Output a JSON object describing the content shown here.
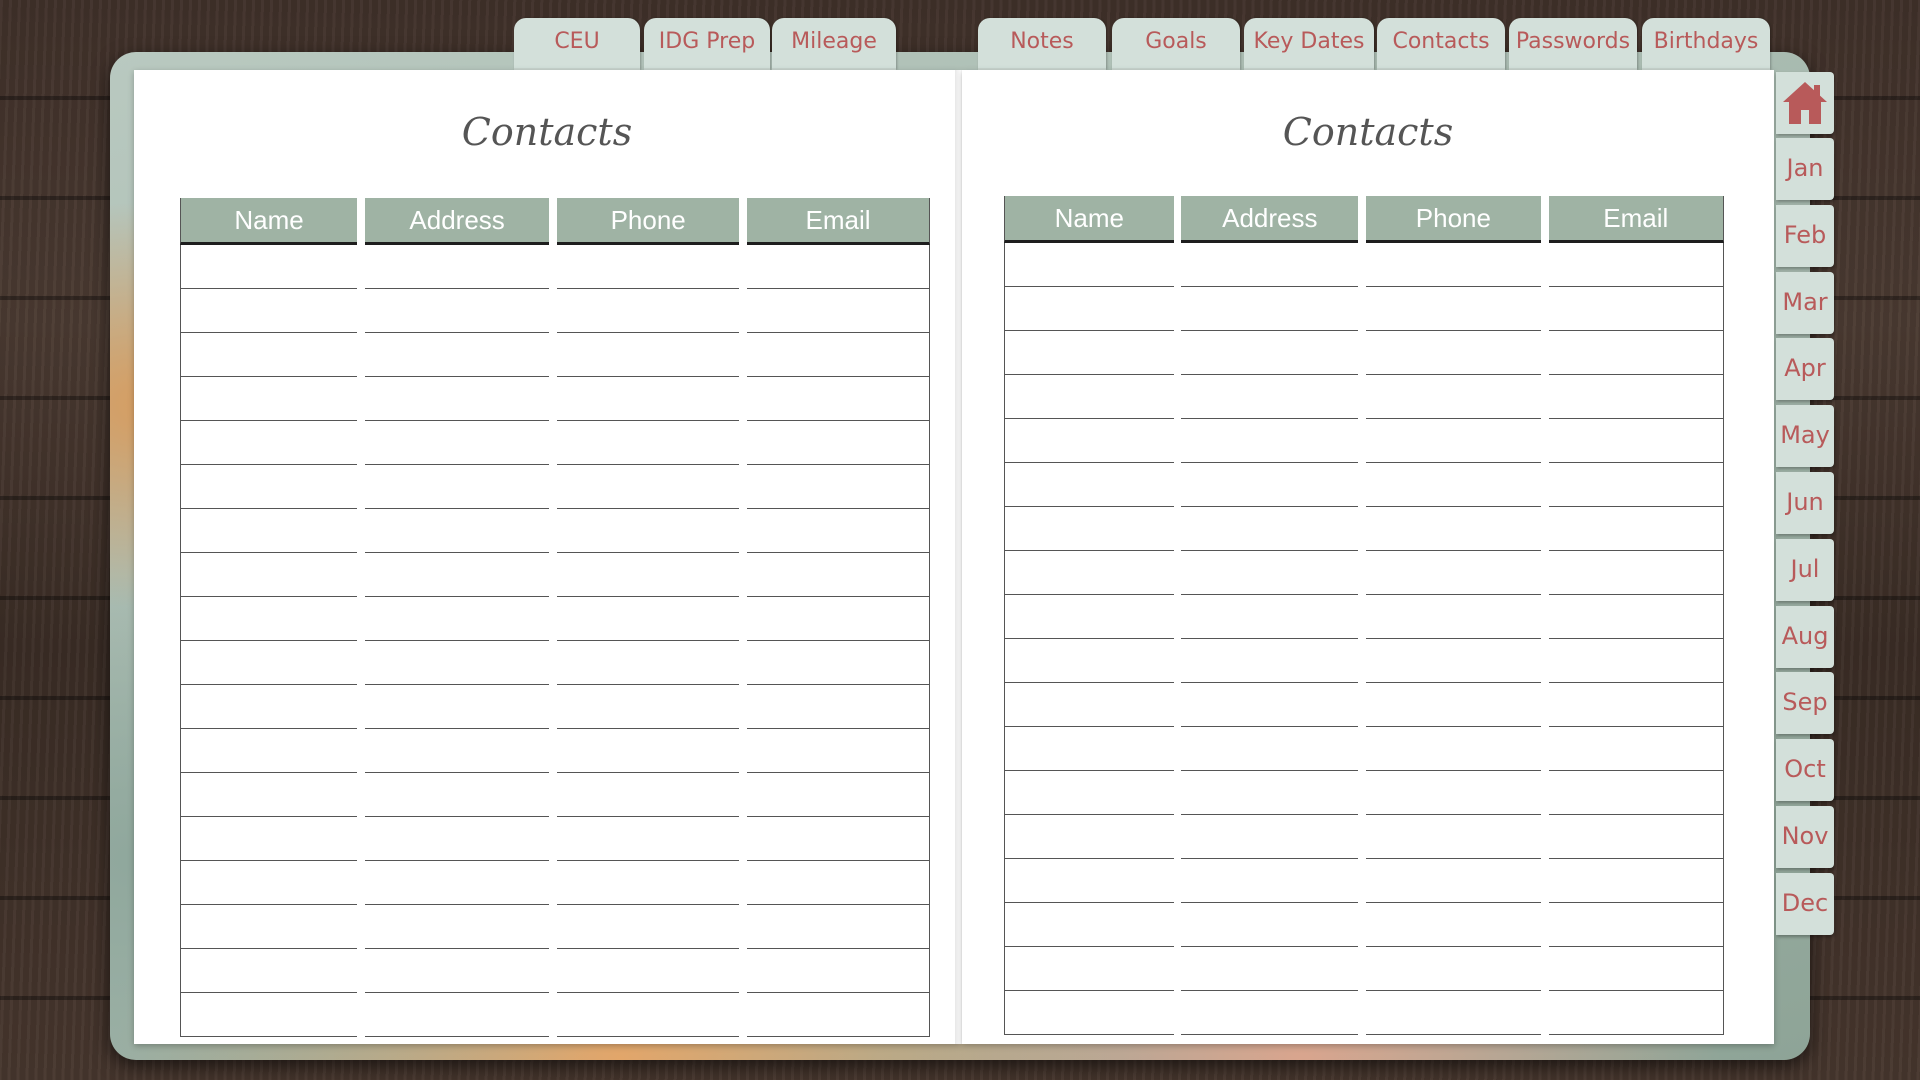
{
  "top_tabs_left": [
    "CEU",
    "IDG Prep",
    "Mileage"
  ],
  "top_tabs_right": [
    "Notes",
    "Goals",
    "Key Dates",
    "Contacts",
    "Passwords",
    "Birthdays"
  ],
  "pages": {
    "left": {
      "title": "Contacts",
      "columns": [
        "Name",
        "Address",
        "Phone",
        "Email"
      ]
    },
    "right": {
      "title": "Contacts",
      "columns": [
        "Name",
        "Address",
        "Phone",
        "Email"
      ]
    }
  },
  "side_tabs": {
    "home_icon": "home-icon",
    "months": [
      "Jan",
      "Feb",
      "Mar",
      "Apr",
      "May",
      "Jun",
      "Jul",
      "Aug",
      "Sep",
      "Oct",
      "Nov",
      "Dec"
    ]
  },
  "colors": {
    "accent_text": "#b85a5a",
    "tab_background": "#d3e0da",
    "header_background": "#9fb3a4"
  }
}
